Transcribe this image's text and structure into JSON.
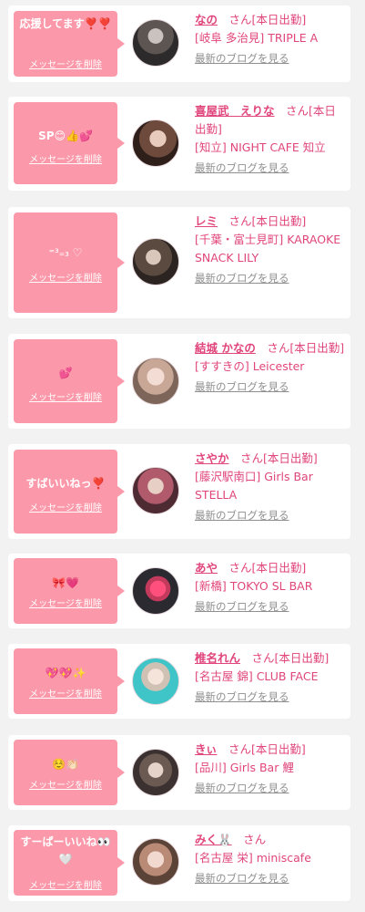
{
  "ui": {
    "delete_label": "メッセージを削除",
    "honorific": "さん",
    "blog_label": "最新のブログを見る",
    "accent_color": "#fb98a9",
    "name_color": "#e0457b"
  },
  "cards": [
    {
      "message": "応援してます❣️❣️",
      "name": "なの",
      "status": "[本日出勤]",
      "shop": "[岐阜 多治見] TRIPLE A",
      "avatar": "avatar-photo-dark-hair"
    },
    {
      "message": "SP😊👍💕",
      "name": "喜屋武　えりな",
      "status": "[本日出勤]",
      "shop": "[知立] NIGHT CAFE 知立",
      "avatar": "avatar-photo-brown-hair"
    },
    {
      "message": "⁼³₌₃ ♡",
      "name": "レミ",
      "status": "[本日出勤]",
      "shop": "[千葉・富士見町] KARAOKE SNACK LILY",
      "avatar": "avatar-photo-long-hair"
    },
    {
      "message": "💕",
      "name": "結城 かなの",
      "status": "[本日出勤]",
      "shop": "[すすきの] Leicester",
      "avatar": "avatar-photo-light-hair"
    },
    {
      "message": "すばいいねっ❣️",
      "name": "さやか",
      "status": "[本日出勤]",
      "shop": "[藤沢駅南口] Girls Bar STELLA",
      "avatar": "avatar-photo-pink-hair"
    },
    {
      "message": "🎀💗",
      "name": "あや",
      "status": "[本日出勤]",
      "shop": "[新橋] TOKYO SL BAR",
      "avatar": "avatar-photo-heart-sticker"
    },
    {
      "message": "💖💖✨",
      "name": "椎名れん",
      "status": "[本日出勤]",
      "shop": "[名古屋 錦] CLUB FACE",
      "avatar": "avatar-photo-teal-background"
    },
    {
      "message": "☺️👏🏻",
      "name": "きぃ",
      "status": "[本日出勤]",
      "shop": "[品川] Girls Bar 鯉",
      "avatar": "avatar-photo-glasses"
    },
    {
      "message": "すーぱーいいね👀🤍",
      "name": "みく🐰",
      "status": "",
      "shop": "[名古屋 栄] miniscafe",
      "avatar": "avatar-photo-cat-ears"
    }
  ]
}
